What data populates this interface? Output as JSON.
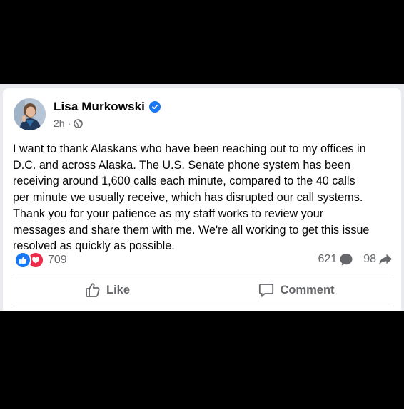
{
  "post": {
    "author": "Lisa Murkowski",
    "verified": true,
    "time": "2h",
    "separator": "·",
    "audience_icon": "globe-icon",
    "text": "I want to thank Alaskans who have been reaching out to my offices in\nD.C. and across Alaska. The U.S. Senate phone system has been\nreceiving around 1,600 calls each minute, compared to the 40 calls\nper minute we usually receive, which has disrupted our call systems.\nThank you for your patience as my staff works to review your\nmessages and share them with me. We're all working to get this issue\nresolved as quickly as possible."
  },
  "engagement": {
    "reaction_icons": [
      "like-reaction-icon",
      "love-reaction-icon"
    ],
    "reaction_count": "709",
    "comment_count": "621",
    "share_count": "98"
  },
  "actions": {
    "like_label": "Like",
    "comment_label": "Comment"
  },
  "colors": {
    "facebook_blue": "#1877f2",
    "love_red": "#f02849",
    "secondary_text": "#65676b",
    "primary_text": "#050505"
  }
}
